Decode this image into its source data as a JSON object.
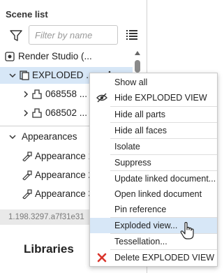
{
  "scene_list": {
    "title": "Scene list",
    "filter_placeholder": "Filter by name",
    "tree": [
      {
        "label": "Render Studio (..."
      },
      {
        "label": "EXPLODED ..."
      },
      {
        "label": "068558 ..."
      },
      {
        "label": "068502 ..."
      }
    ]
  },
  "appearances": {
    "label": "Appearances",
    "items": [
      {
        "label": "Appearance 1"
      },
      {
        "label": "Appearance 2"
      },
      {
        "label": "Appearance 3"
      }
    ]
  },
  "version_text": "1.198.3297.a7f31e31",
  "libraries_label": "Libraries",
  "context_menu": {
    "items": [
      {
        "label": "Show all"
      },
      {
        "label": "Hide EXPLODED VIEW"
      },
      {
        "label": "Hide all parts"
      },
      {
        "label": "Hide all faces"
      },
      {
        "label": "Isolate"
      },
      {
        "label": "Suppress"
      },
      {
        "label": "Update linked document..."
      },
      {
        "label": "Open linked document"
      },
      {
        "label": "Pin reference"
      },
      {
        "label": "Exploded view..."
      },
      {
        "label": "Tessellation..."
      },
      {
        "label": "Delete EXPLODED VIEW"
      }
    ]
  },
  "colors": {
    "selection": "#d7e7f7",
    "delete_icon": "#d9342b"
  }
}
